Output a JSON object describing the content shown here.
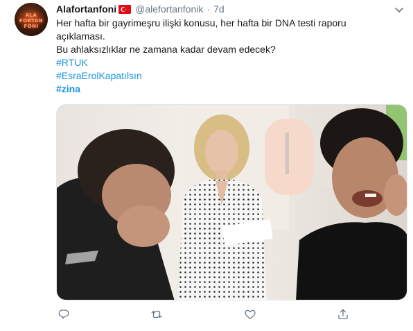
{
  "tweet": {
    "display_name": "Alafortanfoni",
    "handle": "@alefortanfonik",
    "separator": "·",
    "timestamp": "7d",
    "avatar_text": "ALA FORTAN FONI",
    "flag": "turkey-flag",
    "text_lines": [
      "Her hafta bir gayrimeşru ilişki konusu, her hafta bir DNA testi raporu",
      "açıklaması.",
      "Bu ahlaksızlıklar ne zamana kadar devam edecek?"
    ],
    "hashtags": [
      "#RTUK",
      "#EsraErolKapatılsın",
      "#zina"
    ],
    "media": {
      "description_icon": "tv-show-screenshot"
    },
    "actions": [
      {
        "name": "reply",
        "icon": "reply-icon"
      },
      {
        "name": "retweet",
        "icon": "retweet-icon"
      },
      {
        "name": "like",
        "icon": "heart-icon"
      },
      {
        "name": "share",
        "icon": "share-icon"
      }
    ],
    "colors": {
      "link": "#1b95e0",
      "secondary_text": "#657786",
      "action_icon": "#657786",
      "flag_red": "#e30a17"
    }
  }
}
